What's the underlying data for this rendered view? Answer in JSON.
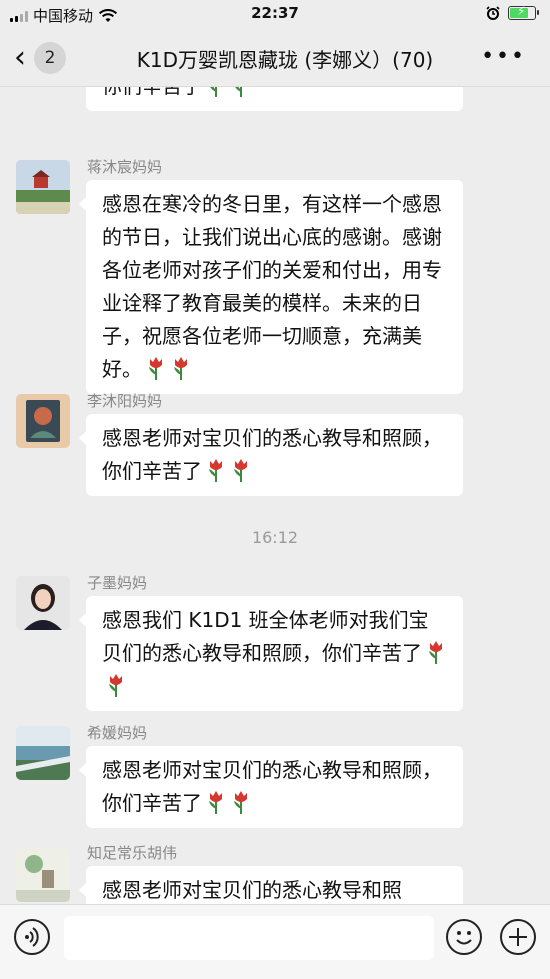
{
  "status_bar": {
    "carrier": "中国移动",
    "time": "22:37"
  },
  "nav": {
    "back_count": "2",
    "title": "K1D万婴凯恩藏珑 (李娜义）(70)"
  },
  "messages": [
    {
      "sender": "",
      "text": "感恩老师对宝贝们的悉心教导和照顾，你们辛苦了",
      "tulips": 2
    },
    {
      "sender": "蒋沐宸妈妈",
      "text": "感恩在寒冷的冬日里，有这样一个感恩的节日，让我们说出心底的感谢。感谢各位老师对孩子们的关爱和付出，用专业诠释了教育最美的模样。未来的日子，祝愿各位老师一切顺意，充满美好。",
      "tulips": 2
    },
    {
      "sender": "李沐阳妈妈",
      "text": "感恩老师对宝贝们的悉心教导和照顾，你们辛苦了",
      "tulips": 2
    },
    {
      "sender": "子墨妈妈",
      "text": "感恩我们 K1D1 班全体老师对我们宝贝们的悉心教导和照顾，你们辛苦了",
      "tulips": 2
    },
    {
      "sender": "希媛妈妈",
      "text": "感恩老师对宝贝们的悉心教导和照顾，你们辛苦了",
      "tulips": 2
    },
    {
      "sender": "知足常乐胡伟",
      "text": "感恩老师对宝贝们的悉心教导和照",
      "tulips": 0
    }
  ],
  "timestamp": "16:12",
  "colors": {
    "background": "#ededed",
    "bubble": "#ffffff",
    "battery": "#4cd964",
    "tulip_red": "#d4382f",
    "tulip_green": "#3d8a3d"
  },
  "icons": [
    "signal-icon",
    "wifi-icon",
    "alarm-icon",
    "battery-icon",
    "back-arrow-icon",
    "more-icon",
    "voice-icon",
    "emoji-icon",
    "plus-icon",
    "tulip-emoji"
  ]
}
